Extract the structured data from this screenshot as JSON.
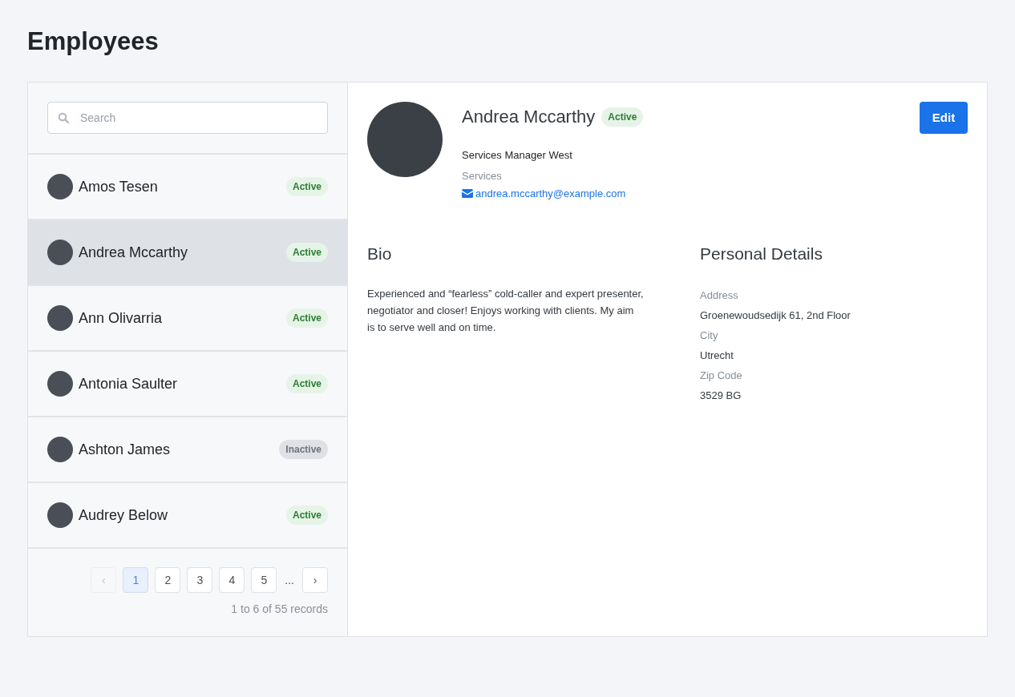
{
  "page": {
    "title": "Employees"
  },
  "search": {
    "placeholder": "Search"
  },
  "employees": [
    {
      "name": "Amos Tesen",
      "status": "Active",
      "kind": "active",
      "selected": false
    },
    {
      "name": "Andrea Mccarthy",
      "status": "Active",
      "kind": "active",
      "selected": true
    },
    {
      "name": "Ann Olivarria",
      "status": "Active",
      "kind": "active",
      "selected": false
    },
    {
      "name": "Antonia Saulter",
      "status": "Active",
      "kind": "active",
      "selected": false
    },
    {
      "name": "Ashton James",
      "status": "Inactive",
      "kind": "inactive",
      "selected": false
    },
    {
      "name": "Audrey Below",
      "status": "Active",
      "kind": "active",
      "selected": false
    }
  ],
  "pagination": {
    "prev": {
      "label": "‹",
      "disabled": true
    },
    "pages": [
      {
        "label": "1",
        "selected": true
      },
      {
        "label": "2",
        "selected": false
      },
      {
        "label": "3",
        "selected": false
      },
      {
        "label": "4",
        "selected": false
      },
      {
        "label": "5",
        "selected": false
      }
    ],
    "ellipsis": "...",
    "next": {
      "label": "›",
      "disabled": false
    },
    "summary": "1 to 6 of 55 records"
  },
  "detail": {
    "name": "Andrea Mccarthy",
    "status": "Active",
    "kind": "active",
    "edit_button": "Edit",
    "job_title": "Services Manager West",
    "department": "Services",
    "email": "andrea.mccarthy@example.com",
    "bio": {
      "heading": "Bio",
      "text": "Experienced and “fearless” cold-caller and expert presenter, negotiator and closer! Enjoys working with clients. My aim is to serve well and on time."
    },
    "personal_details": {
      "heading": "Personal Details",
      "fields": [
        {
          "label": "Address",
          "value": "Groenewoudsedijk 61, 2nd Floor"
        },
        {
          "label": "City",
          "value": "Utrecht"
        },
        {
          "label": "Zip Code",
          "value": "3529 BG"
        }
      ]
    }
  }
}
